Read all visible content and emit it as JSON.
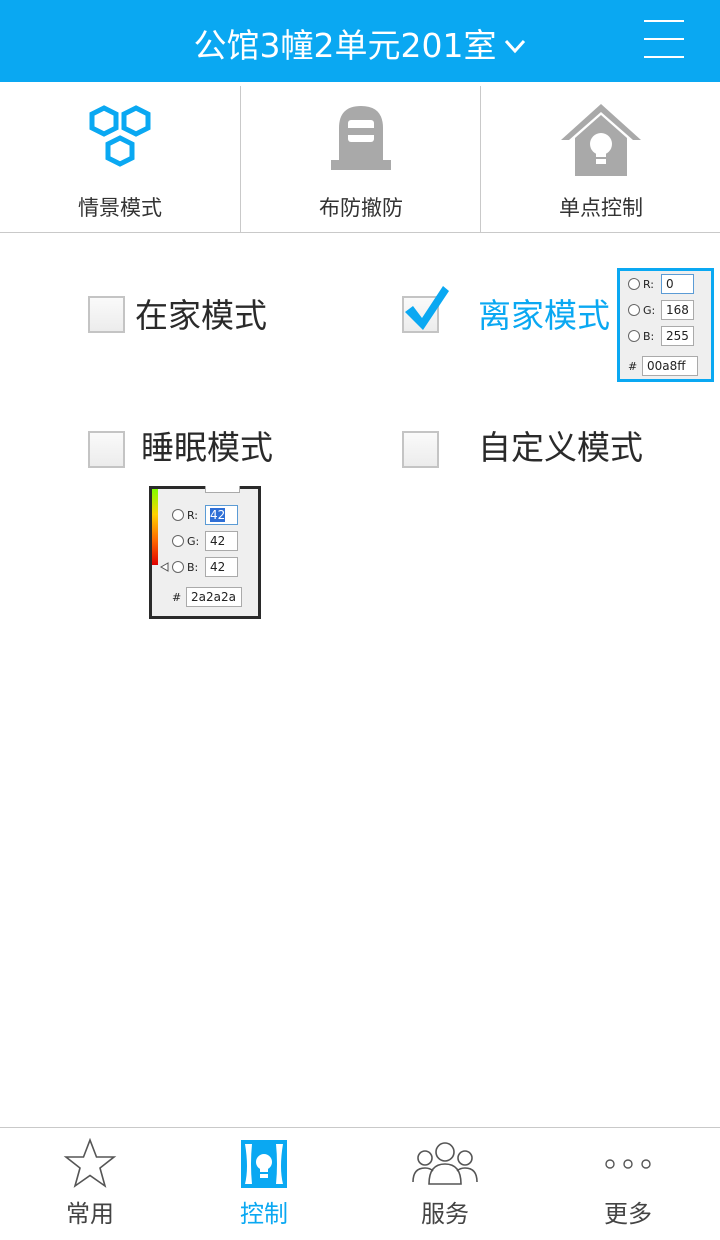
{
  "header": {
    "title": "公馆3幢2单元201室"
  },
  "tabs": [
    {
      "label": "情景模式",
      "icon": "hexagon-cluster-icon",
      "active": true
    },
    {
      "label": "布防撤防",
      "icon": "arm-disarm-icon"
    },
    {
      "label": "单点控制",
      "icon": "house-bulb-icon"
    }
  ],
  "modes": [
    {
      "label": "在家模式",
      "checked": false
    },
    {
      "label": "离家模式",
      "checked": true
    },
    {
      "label": "睡眠模式",
      "checked": false
    },
    {
      "label": "自定义模式",
      "checked": false
    }
  ],
  "picker_away": {
    "r_label": "R:",
    "r": "0",
    "g_label": "G:",
    "g": "168",
    "b_label": "B:",
    "b": "255",
    "hash": "#",
    "hex": "00a8ff"
  },
  "picker_sleep": {
    "r_label": "R:",
    "r": "42",
    "g_label": "G:",
    "g": "42",
    "b_label": "B:",
    "b": "42",
    "hash": "#",
    "hex": "2a2a2a"
  },
  "bottom_nav": [
    {
      "label": "常用",
      "icon": "star-icon"
    },
    {
      "label": "控制",
      "icon": "curtain-bulb-icon",
      "active": true
    },
    {
      "label": "服务",
      "icon": "people-icon"
    },
    {
      "label": "更多",
      "icon": "more-dots-icon"
    }
  ],
  "colors": {
    "accent": "#0aa8f2",
    "text": "#2a2a2a",
    "icon_gray": "#a9a9a9"
  }
}
